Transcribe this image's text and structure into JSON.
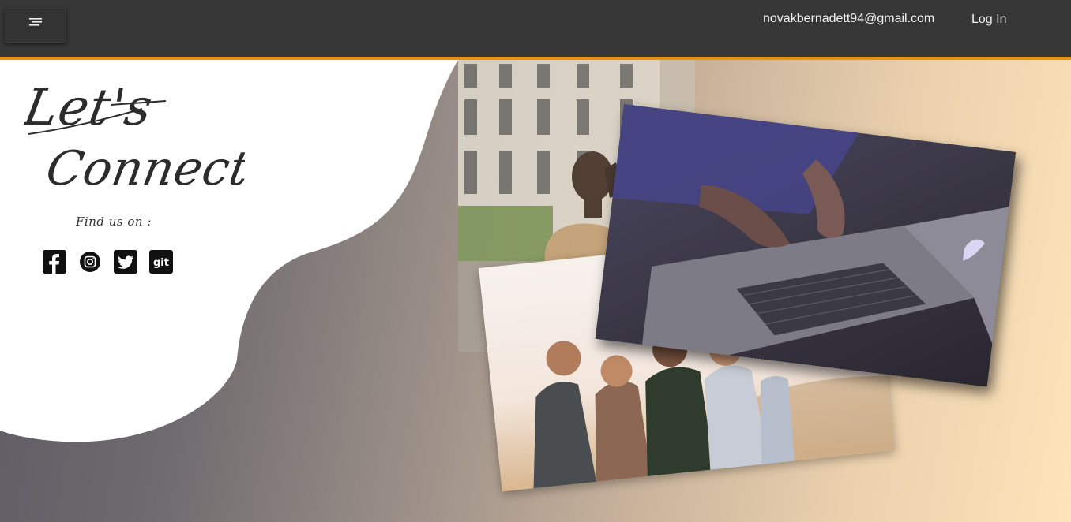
{
  "navbar": {
    "menu_icon": "menu-lines-icon",
    "email": "novakbernadett94@gmail.com",
    "login_label": "Log In"
  },
  "hero": {
    "title": "Let's Connect!",
    "find_us_label": "Find us on :",
    "social": [
      {
        "icon": "facebook-icon"
      },
      {
        "icon": "instagram-icon"
      },
      {
        "icon": "twitter-icon"
      },
      {
        "icon": "git-icon",
        "text": "git"
      }
    ]
  },
  "photos": [
    {
      "icon": "building-photo"
    },
    {
      "icon": "laptop-photo"
    },
    {
      "icon": "friends-photo"
    }
  ],
  "colors": {
    "navbar_bg": "#363636",
    "accent_border": "#e8920f",
    "text_light": "#f2f2f2",
    "icon_dark": "#111111"
  }
}
